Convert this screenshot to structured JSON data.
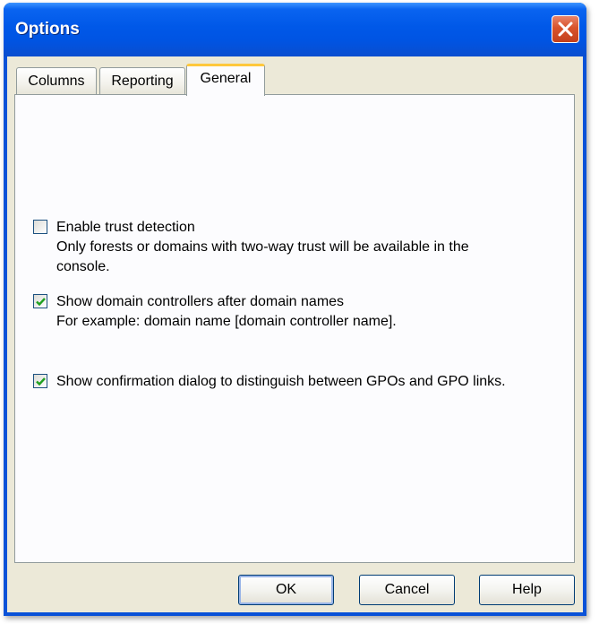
{
  "window": {
    "title": "Options"
  },
  "tabs": [
    {
      "label": "Columns",
      "active": false
    },
    {
      "label": "Reporting",
      "active": false
    },
    {
      "label": "General",
      "active": true
    }
  ],
  "options": [
    {
      "label": "Enable trust detection",
      "description_line1": "Only forests or domains with two-way trust will be available in the",
      "description_line2": "console.",
      "checked": false
    },
    {
      "label": "Show domain controllers after domain names",
      "description_line1": "For example: domain name [domain controller name].",
      "checked": true
    },
    {
      "label": "Show confirmation dialog to distinguish between GPOs and GPO links.",
      "checked": true
    }
  ],
  "buttons": {
    "ok": "OK",
    "cancel": "Cancel",
    "help": "Help"
  },
  "icons": {
    "close": "close-icon",
    "check": "checkmark-icon"
  },
  "colors": {
    "titlebar": "#0054e3",
    "close_button": "#d8532c",
    "active_tab_accent": "#ffc83c",
    "dialog_background": "#ece9d8",
    "checkmark": "#21a121"
  }
}
